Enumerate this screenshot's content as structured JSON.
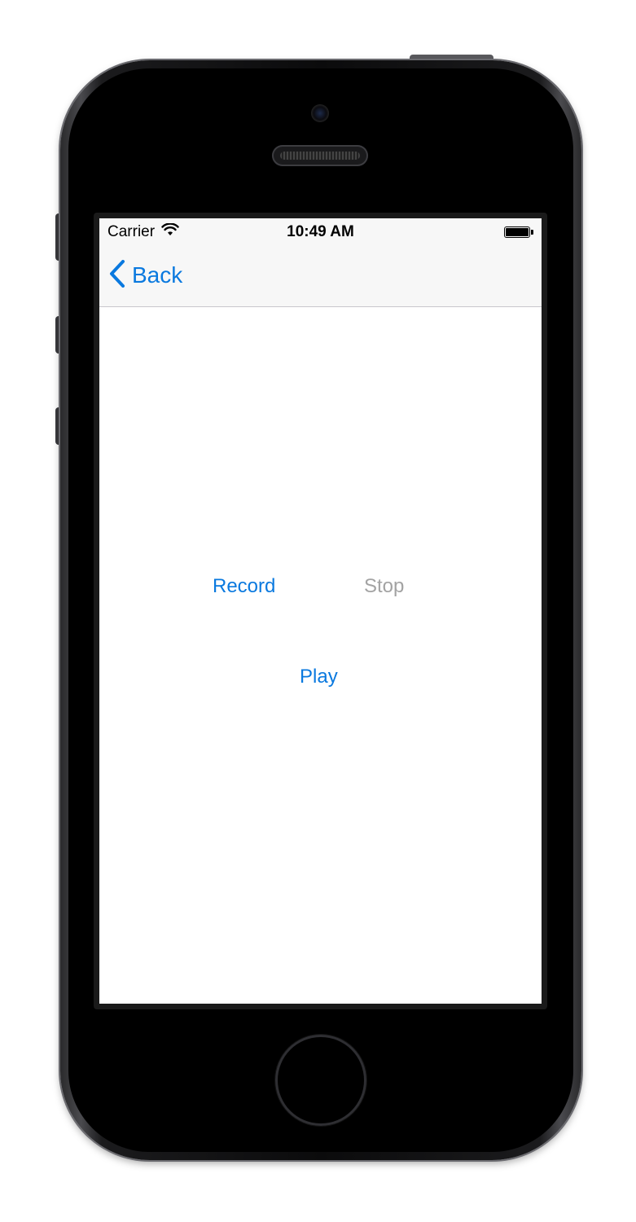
{
  "status_bar": {
    "carrier": "Carrier",
    "time": "10:49 AM",
    "wifi_icon": "wifi-icon",
    "battery_icon": "battery-icon"
  },
  "nav": {
    "back_label": "Back",
    "back_icon": "chevron-left-icon"
  },
  "controls": {
    "record_label": "Record",
    "stop_label": "Stop",
    "play_label": "Play"
  },
  "colors": {
    "accent": "#0a79df",
    "disabled": "#a3a3a3",
    "navbar_bg": "#f7f7f7"
  }
}
